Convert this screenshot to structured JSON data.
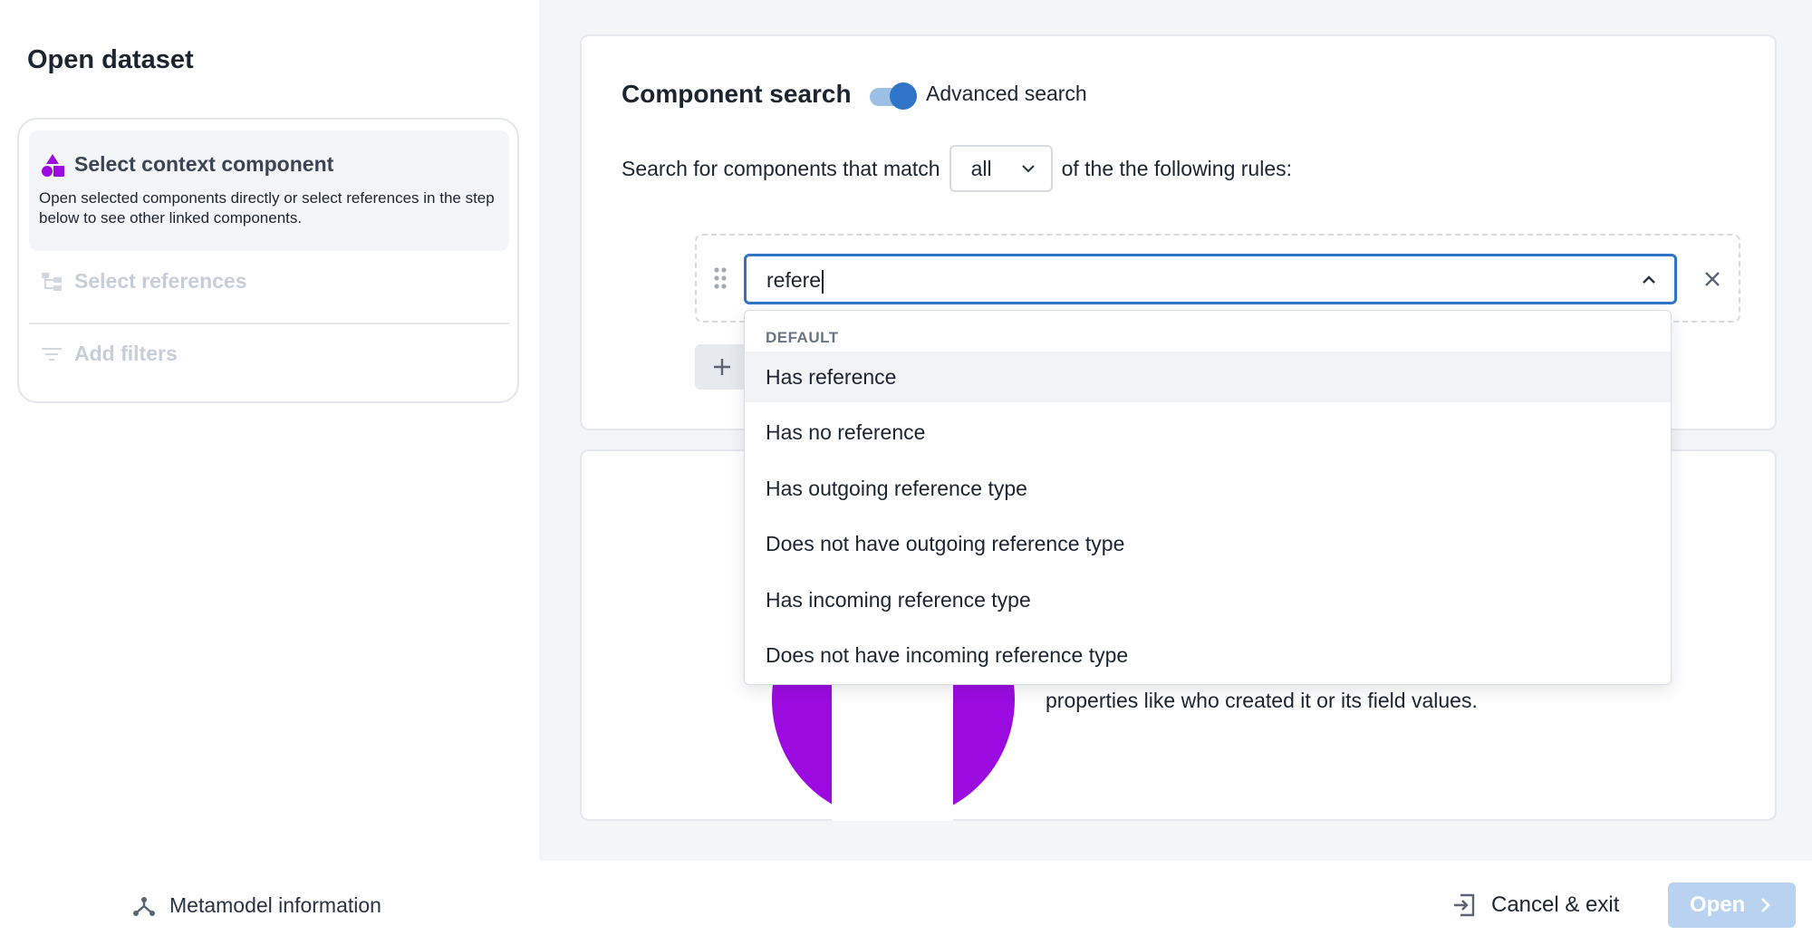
{
  "sidebar": {
    "title": "Open dataset",
    "steps": [
      {
        "title": "Select context component",
        "description": "Open selected components directly or select references in the step below to see other linked components.",
        "state": "active",
        "icon": "shapes-icon"
      },
      {
        "title": "Select references",
        "state": "disabled",
        "icon": "hierarchy-icon"
      },
      {
        "title": "Add filters",
        "state": "disabled",
        "icon": "filter-icon"
      }
    ],
    "metamodel_label": "Metamodel information"
  },
  "search": {
    "title": "Component search",
    "advanced_label": "Advanced search",
    "advanced_enabled": true,
    "match_prefix": "Search for components that match",
    "match_value": "all",
    "match_suffix": "of the the following rules:",
    "rule_input_value": "refere"
  },
  "dropdown": {
    "group_label": "DEFAULT",
    "options": [
      "Has reference",
      "Has no reference",
      "Has outgoing reference type",
      "Does not have outgoing reference type",
      "Has incoming reference type",
      "Does not have incoming reference type"
    ],
    "highlighted_index": 0
  },
  "info": {
    "text": "properties like who created it or its field values."
  },
  "footer": {
    "cancel_label": "Cancel & exit",
    "open_label": "Open"
  },
  "colors": {
    "accent": "#2f74c7",
    "brand_purple": "#9b0be0",
    "open_disabled": "#b8d2ef"
  }
}
